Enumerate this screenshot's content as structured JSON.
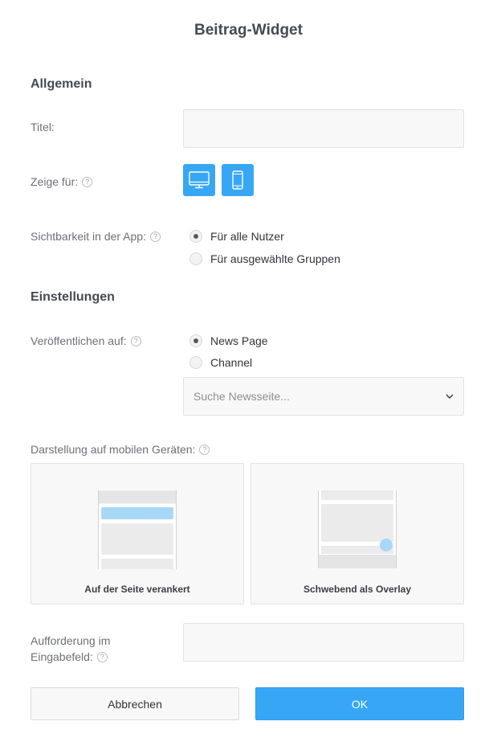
{
  "dialog": {
    "title": "Beitrag-Widget"
  },
  "general": {
    "heading": "Allgemein",
    "title_label": "Titel:",
    "title_value": "",
    "show_for_label": "Zeige für:",
    "devices": [
      {
        "name": "desktop-icon",
        "selected": true
      },
      {
        "name": "mobile-icon",
        "selected": true
      }
    ],
    "visibility_label": "Sichtbarkeit in der App:",
    "visibility_options": [
      "Für alle Nutzer",
      "Für ausgewählte Gruppen"
    ],
    "visibility_selected": 0
  },
  "settings": {
    "heading": "Einstellungen",
    "publish_label": "Veröffentlichen auf:",
    "publish_options": [
      "News Page",
      "Channel"
    ],
    "publish_selected": 0,
    "search_placeholder": "Suche Newsseite...",
    "mobile_display_label": "Darstellung auf mobilen Geräten:",
    "mobile_display_options": [
      "Auf der Seite verankert",
      "Schwebend als Overlay"
    ],
    "prompt_label_line1": "Aufforderung im",
    "prompt_label_line2": "Eingabefeld:",
    "prompt_value": ""
  },
  "help_icon": "?",
  "buttons": {
    "cancel": "Abbrechen",
    "ok": "OK"
  },
  "colors": {
    "accent": "#37a7f5",
    "preview_bar": "#a8d8f8",
    "overlay_dot": "#a8d8f8"
  }
}
